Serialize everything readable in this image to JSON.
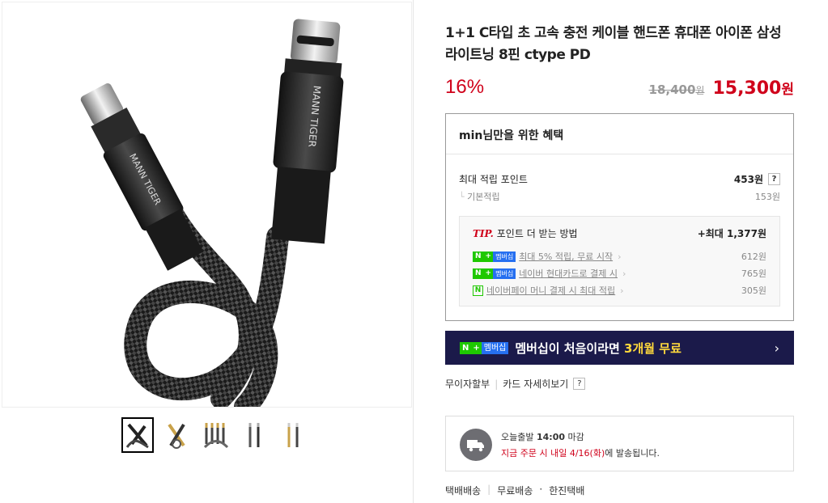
{
  "product": {
    "title": "1+1 C타입 초 고속 충전 케이블 핸드폰 휴대폰 아이폰 삼성 라이트닝 8핀 ctype PD",
    "discount": "16%",
    "original_price": "18,400",
    "original_currency": "원",
    "sale_price": "15,300",
    "sale_currency": "원"
  },
  "image": {
    "brand_text_1": "MANN TIGER",
    "brand_text_2": "MANN TIGER"
  },
  "benefits": {
    "user": "min",
    "heading_suffix": "님만을 위한 혜택",
    "max_label": "최대 적립 포인트",
    "max_value": "453원",
    "help": "?",
    "basic_label": "기본적립",
    "basic_value": "153원",
    "tip_word": "TIP.",
    "tip_title": "포인트 더 받는 방법",
    "tip_max": "+최대 1,377원",
    "tips": [
      {
        "badge": "membership",
        "label": "최대 5% 적립, 무료 시작",
        "value": "612원"
      },
      {
        "badge": "membership",
        "label": "네이버 현대카드로 결제 시",
        "value": "765원"
      },
      {
        "badge": "pay",
        "label": "네이버페이 머니 결제 시 최대 적립",
        "value": "305원"
      }
    ],
    "badge_n": "N",
    "badge_plus": "+",
    "badge_m": "멤버십",
    "badge_pay": "N"
  },
  "banner": {
    "text": "멤버십이 처음이라면 ",
    "highlight": "3개월 무료",
    "arrow": "›"
  },
  "card_links": {
    "installment": "무이자할부",
    "card_detail": "카드 자세히보기",
    "help": "?"
  },
  "shipping": {
    "line1_prefix": "오늘출발 ",
    "line1_time": "14:00",
    "line1_suffix": " 마감",
    "line2_red": "지금 주문 시 내일 4/16(화)",
    "line2_rest": "에 발송됩니다."
  },
  "delivery": {
    "type": "택배배송",
    "fee": "무료배송",
    "carrier": "한진택배",
    "dot": "·"
  },
  "colors": {
    "price_red": "#d0021b",
    "naver_green": "#1ec800",
    "banner_bg": "#1b1a4a",
    "banner_highlight": "#ffd93c"
  }
}
